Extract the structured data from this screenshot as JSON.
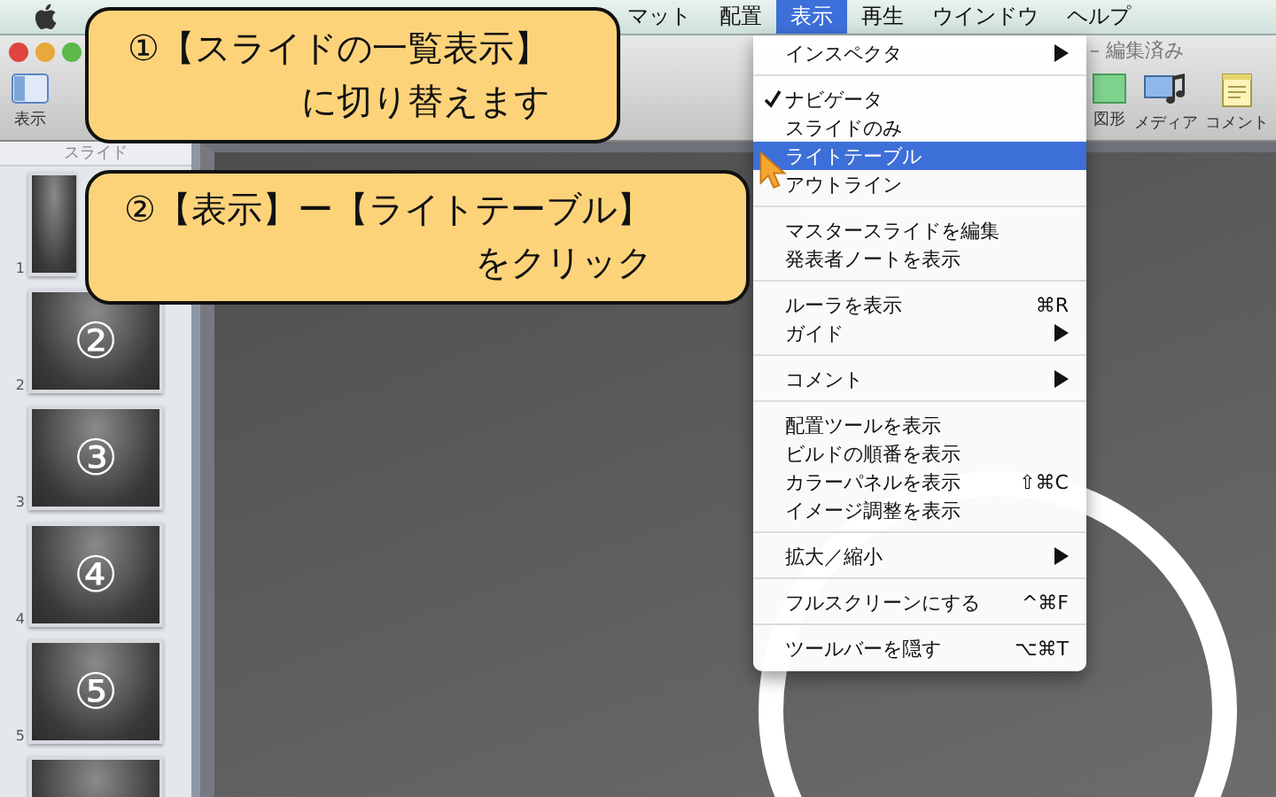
{
  "menubar": {
    "items": [
      {
        "label": "マット",
        "selected": false
      },
      {
        "label": "配置",
        "selected": false
      },
      {
        "label": "表示",
        "selected": true
      },
      {
        "label": "再生",
        "selected": false
      },
      {
        "label": "ウインドウ",
        "selected": false
      },
      {
        "label": "ヘルプ",
        "selected": false
      }
    ]
  },
  "window": {
    "title": "– 編集済み"
  },
  "toolbar": {
    "left": [
      {
        "kind": "view",
        "label": "表示"
      }
    ],
    "right": [
      {
        "kind": "shape",
        "label": "図形"
      },
      {
        "kind": "media",
        "label": "メディア"
      },
      {
        "kind": "comment",
        "label": "コメント"
      }
    ]
  },
  "sidebar": {
    "header": "スライド",
    "slides": [
      {
        "kind": "covered",
        "number": "1"
      },
      {
        "kind": "thumbnail",
        "number": "2",
        "label": "②"
      },
      {
        "kind": "thumbnail",
        "number": "3",
        "label": "③"
      },
      {
        "kind": "thumbnail",
        "number": "4",
        "label": "④"
      },
      {
        "kind": "thumbnail",
        "number": "5",
        "label": "⑤"
      },
      {
        "kind": "cut"
      }
    ]
  },
  "slide": {
    "kind": "ring"
  },
  "menu": {
    "sections": [
      [
        {
          "label": "インスペクタ",
          "checked": false,
          "selected": false,
          "submenu": true
        }
      ],
      [
        {
          "label": "ナビゲータ",
          "checked": true,
          "selected": false,
          "submenu": false
        },
        {
          "label": "スライドのみ",
          "checked": false,
          "selected": false,
          "submenu": false
        },
        {
          "label": "ライトテーブル",
          "checked": false,
          "selected": true,
          "submenu": false
        },
        {
          "label": "アウトライン",
          "checked": false,
          "selected": false,
          "submenu": false
        }
      ],
      [
        {
          "label": "マスタースライドを編集",
          "checked": false,
          "selected": false,
          "submenu": false
        },
        {
          "label": "発表者ノートを表示",
          "checked": false,
          "selected": false,
          "submenu": false
        }
      ],
      [
        {
          "label": "ルーラを表示",
          "shortcut": "⌘R",
          "checked": false,
          "selected": false,
          "submenu": false
        },
        {
          "label": "ガイド",
          "checked": false,
          "selected": false,
          "submenu": true
        }
      ],
      [
        {
          "label": "コメント",
          "checked": false,
          "selected": false,
          "submenu": true
        }
      ],
      [
        {
          "label": "配置ツールを表示",
          "checked": false,
          "selected": false,
          "submenu": false
        },
        {
          "label": "ビルドの順番を表示",
          "checked": false,
          "selected": false,
          "submenu": false
        },
        {
          "label": "カラーパネルを表示",
          "shortcut": "⇧⌘C",
          "checked": false,
          "selected": false,
          "submenu": false
        },
        {
          "label": "イメージ調整を表示",
          "checked": false,
          "selected": false,
          "submenu": false
        }
      ],
      [
        {
          "label": "拡大／縮小",
          "checked": false,
          "selected": false,
          "submenu": true
        }
      ],
      [
        {
          "label": "フルスクリーンにする",
          "shortcut": "^⌘F",
          "checked": false,
          "selected": false,
          "submenu": false
        }
      ],
      [
        {
          "label": "ツールバーを隠す",
          "shortcut": "⌥⌘T",
          "checked": false,
          "selected": false,
          "submenu": false
        }
      ]
    ]
  },
  "callouts": [
    {
      "lines": [
        "①【スライドの一覧表示】",
        "に切り替えます"
      ]
    },
    {
      "lines": [
        "②【表示】ー【ライトテーブル】",
        "をクリック"
      ]
    }
  ]
}
